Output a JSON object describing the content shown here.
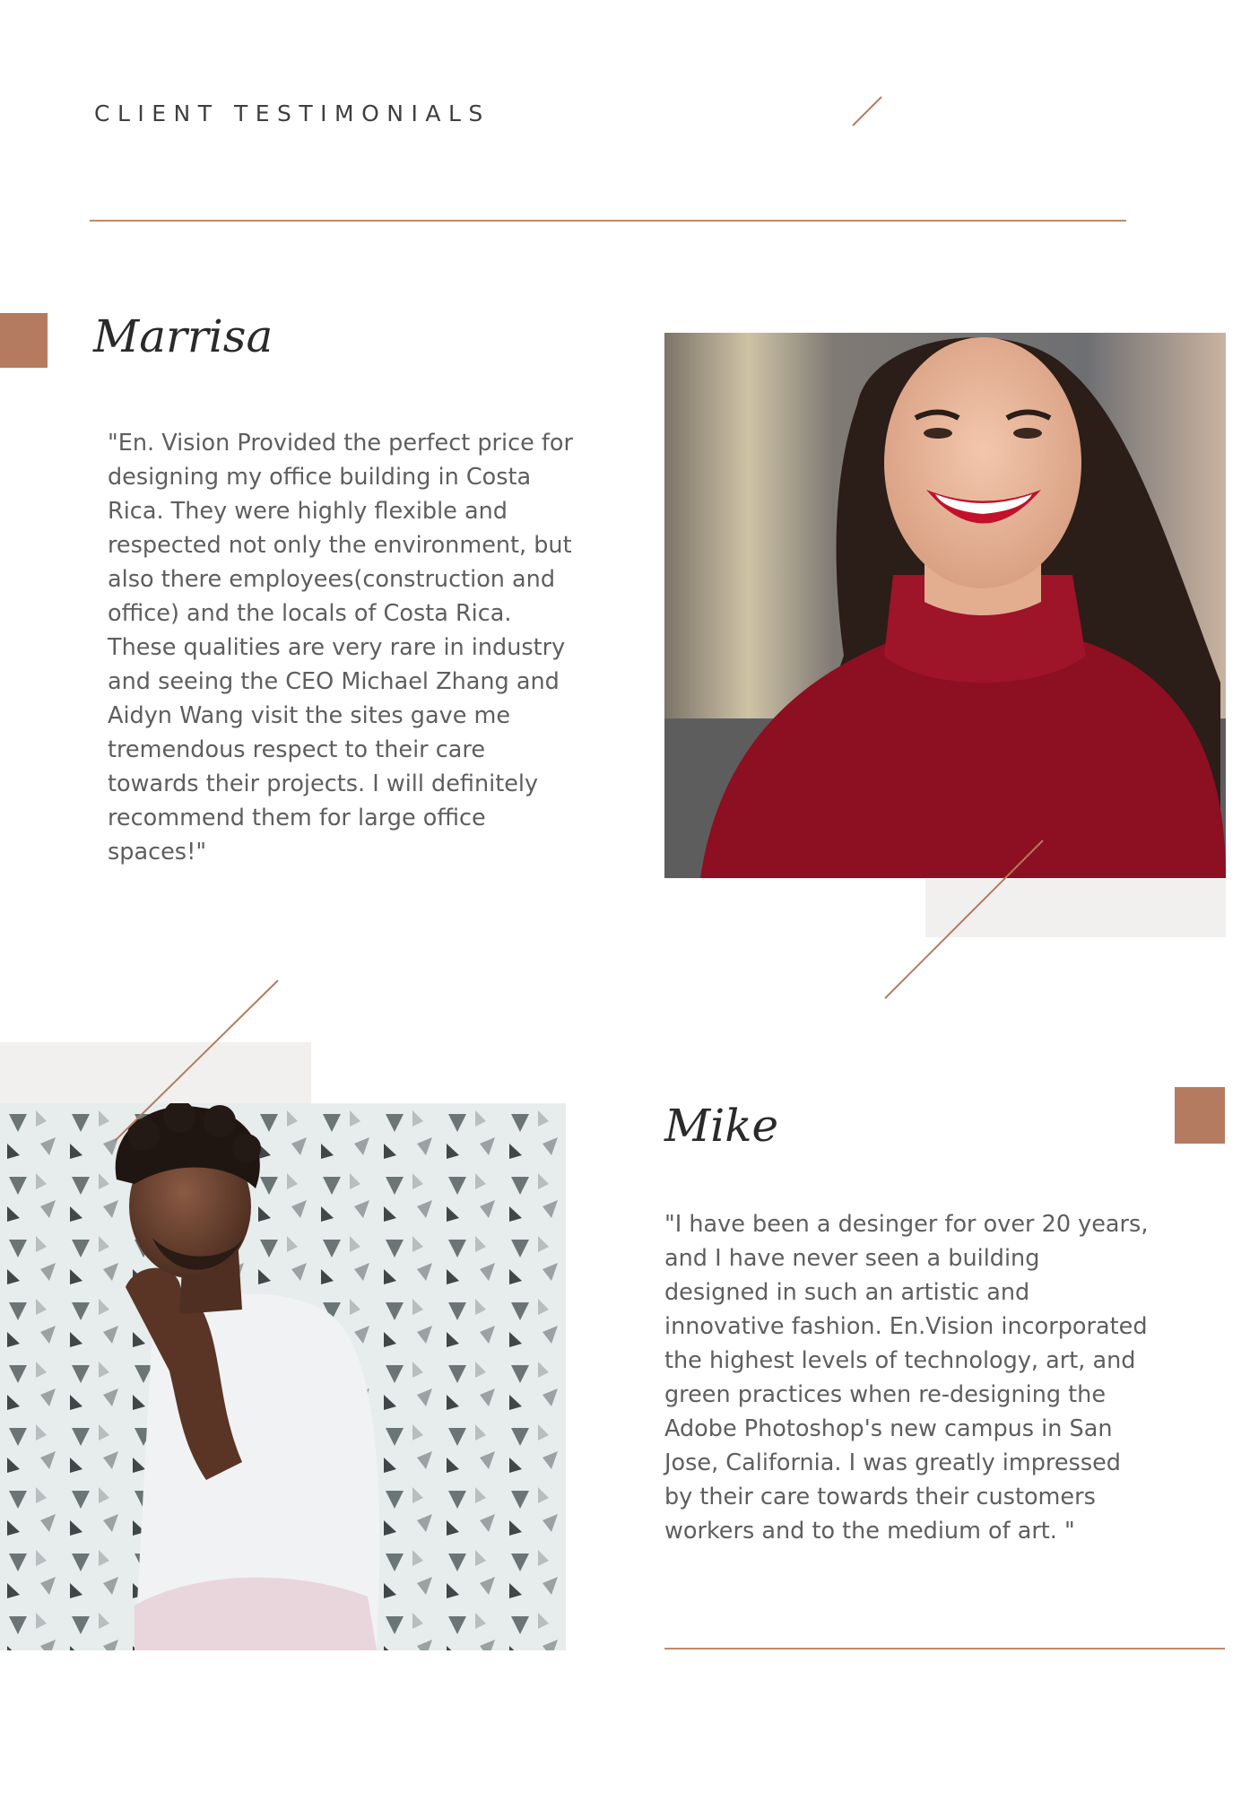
{
  "header": {
    "title": "CLIENT TESTIMONIALS"
  },
  "testimonials": [
    {
      "name": "Marrisa",
      "quote": "\"En. Vision Provided the perfect price for designing my office building in Costa Rica. They were highly flexible and respected not only the environment, but also there employees(construction and office) and the locals of Costa Rica. These qualities are very rare in industry and seeing the CEO Michael Zhang and Aidyn Wang visit the sites gave me tremendous respect to their care towards their projects. I will definitely recommend them for large office spaces!\""
    },
    {
      "name": "Mike",
      "quote": "\"I have been a desinger for over 20 years, and I have never seen a building designed in such an artistic and innovative fashion. En.Vision incorporated the highest levels of technology, art, and green practices when re-designing the Adobe Photoshop's new campus in San Jose, California. I was greatly impressed by their care towards their customers workers and to the medium of art. \""
    }
  ],
  "colors": {
    "accent": "#b47b60",
    "rule": "#c08a6b",
    "block": "#f1f0ee",
    "text": "#5e5e5e"
  },
  "icons": [
    "diagonal-accent-line",
    "accent-square"
  ]
}
